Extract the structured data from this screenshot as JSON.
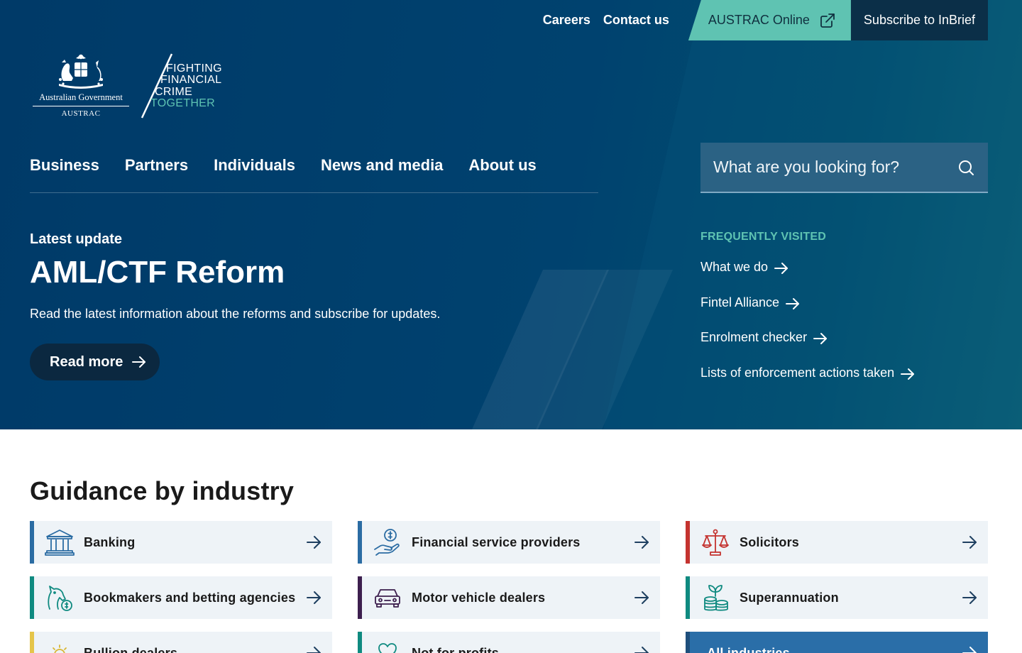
{
  "topbar": {
    "careers": "Careers",
    "contact": "Contact us",
    "austrac_online": "AUSTRAC Online",
    "subscribe": "Subscribe to InBrief"
  },
  "logo": {
    "government": "Australian Government",
    "agency": "AUSTRAC",
    "tagline": [
      "FIGHTING",
      "FINANCIAL",
      "CRIME",
      "TOGETHER"
    ]
  },
  "nav": [
    "Business",
    "Partners",
    "Individuals",
    "News and media",
    "About us"
  ],
  "search": {
    "placeholder": "What are you looking for?"
  },
  "hero": {
    "eyebrow": "Latest update",
    "title": "AML/CTF Reform",
    "description": "Read the latest information about the reforms and subscribe for updates.",
    "button": "Read more"
  },
  "frequently_visited": {
    "title": "FREQUENTLY VISITED",
    "links": [
      "What we do",
      "Fintel Alliance",
      "Enrolment checker",
      "Lists of enforcement actions taken"
    ]
  },
  "guidance": {
    "title": "Guidance by industry",
    "cards": [
      {
        "label": "Banking",
        "icon": "bank-icon",
        "accent": "#2b6ca3"
      },
      {
        "label": "Financial service providers",
        "icon": "hand-coin-icon",
        "accent": "#2b6ca3"
      },
      {
        "label": "Solicitors",
        "icon": "scales-icon",
        "accent": "#c4332f"
      },
      {
        "label": "Bookmakers and betting agencies",
        "icon": "horse-coin-icon",
        "accent": "#0f8a80"
      },
      {
        "label": "Motor vehicle dealers",
        "icon": "car-icon",
        "accent": "#3d1f4e"
      },
      {
        "label": "Superannuation",
        "icon": "plant-coins-icon",
        "accent": "#0f8a80"
      },
      {
        "label": "Bullion dealers",
        "icon": "sun-icon",
        "accent": "#e5c54a"
      },
      {
        "label": "Not for profits",
        "icon": "heart-icon",
        "accent": "#0f8a80"
      },
      {
        "label": "All industries",
        "icon": "",
        "accent": "#1e4f7c"
      }
    ]
  },
  "colors": {
    "hero_bg": "#003a68",
    "teal_accent": "#5fc3b2",
    "subscribe_bg": "#0b2f48"
  }
}
